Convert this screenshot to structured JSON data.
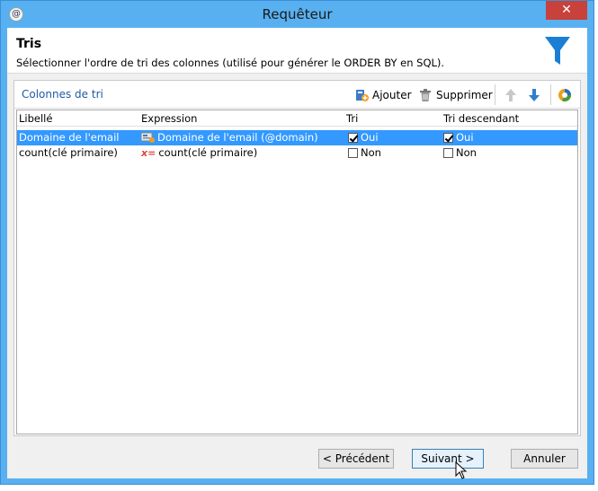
{
  "window": {
    "title": "Requêteur",
    "close_label": "✕"
  },
  "header": {
    "title": "Tris",
    "description": "Sélectionner l'ordre de tri des colonnes (utilisé pour générer le ORDER BY en SQL)."
  },
  "toolbar": {
    "label": "Colonnes de tri",
    "add_label": "Ajouter",
    "delete_label": "Supprimer"
  },
  "grid": {
    "columns": [
      "Libellé",
      "Expression",
      "Tri",
      "Tri descendant"
    ],
    "rows": [
      {
        "label": "Domaine de l'email",
        "expression": "Domaine de l'email (@domain)",
        "sort": "Oui",
        "sort_checked": true,
        "desc": "Oui",
        "desc_checked": true,
        "selected": true
      },
      {
        "label": "count(clé primaire)",
        "expression": "count(clé primaire)",
        "sort": "Non",
        "sort_checked": false,
        "desc": "Non",
        "desc_checked": false,
        "selected": false
      }
    ]
  },
  "footer": {
    "previous_label": "< Précédent",
    "next_label": "Suivant >",
    "cancel_label": "Annuler"
  }
}
